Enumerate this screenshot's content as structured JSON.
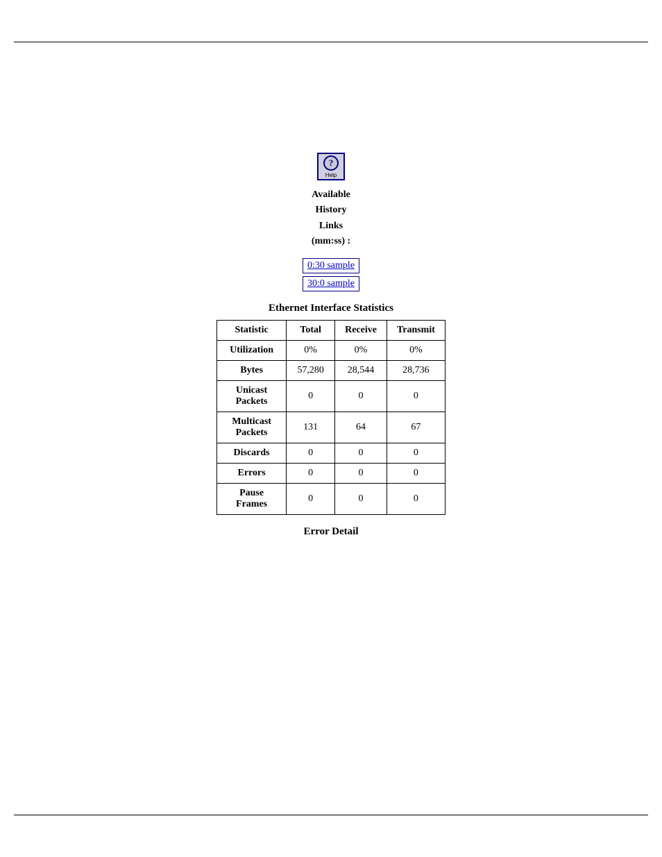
{
  "page": {
    "top_rule": true,
    "bottom_rule": true
  },
  "help_icon": {
    "symbol": "?",
    "label": "Help"
  },
  "available_history": {
    "line1": "Available",
    "line2": "History",
    "line3": "Links",
    "line4": "(mm:ss) :"
  },
  "history_links": [
    {
      "text": "0:30 sample",
      "id": "link-030"
    },
    {
      "text": "30:0 sample",
      "id": "link-300"
    }
  ],
  "ethernet_stats": {
    "section_title": "Ethernet Interface Statistics",
    "columns": [
      "Statistic",
      "Total",
      "Receive",
      "Transmit"
    ],
    "rows": [
      {
        "label": "Utilization",
        "total": "0%",
        "receive": "0%",
        "transmit": "0%"
      },
      {
        "label": "Bytes",
        "total": "57,280",
        "receive": "28,544",
        "transmit": "28,736"
      },
      {
        "label": "Unicast\nPackets",
        "total": "0",
        "receive": "0",
        "transmit": "0"
      },
      {
        "label": "Multicast\nPackets",
        "total": "131",
        "receive": "64",
        "transmit": "67"
      },
      {
        "label": "Discards",
        "total": "0",
        "receive": "0",
        "transmit": "0"
      },
      {
        "label": "Errors",
        "total": "0",
        "receive": "0",
        "transmit": "0"
      },
      {
        "label": "Pause\nFrames",
        "total": "0",
        "receive": "0",
        "transmit": "0"
      }
    ]
  },
  "error_detail": {
    "title": "Error Detail"
  }
}
